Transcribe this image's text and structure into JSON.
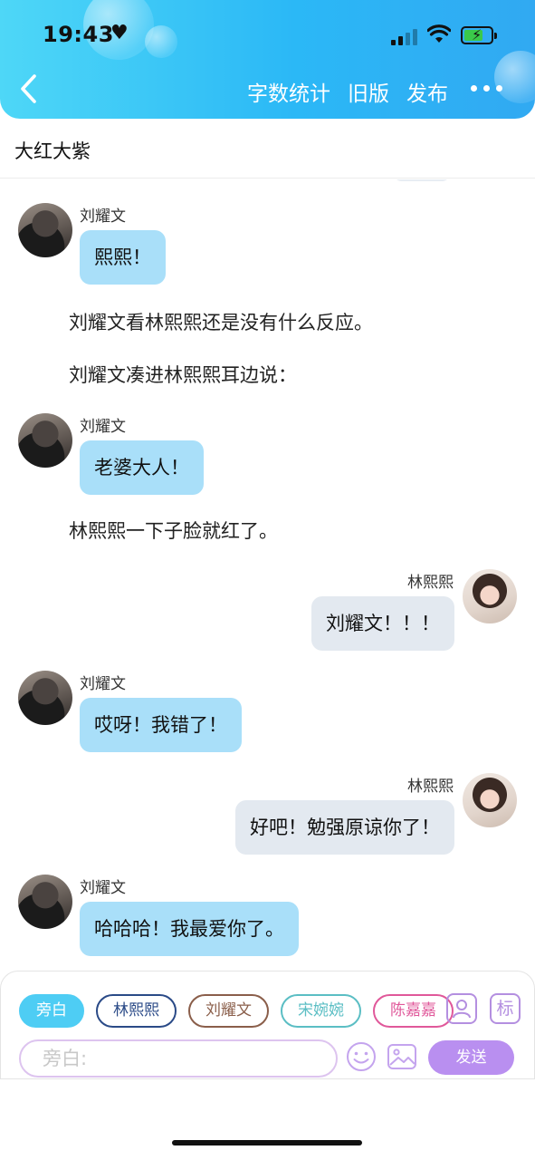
{
  "status_bar": {
    "time": "19:43",
    "time_icon": "heart"
  },
  "nav": {
    "back_icon": "chevron-left",
    "actions": [
      "字数统计",
      "旧版",
      "发布"
    ],
    "more_icon": "ellipsis"
  },
  "title": "大红大紫",
  "characters": {
    "liu": "刘耀文",
    "lin": "林熙熙"
  },
  "messages": [
    {
      "type": "left",
      "name": "刘耀文",
      "text": "熙熙！"
    },
    {
      "type": "narration",
      "text": "刘耀文看林熙熙还是没有什么反应。"
    },
    {
      "type": "narration",
      "text": "刘耀文凑进林熙熙耳边说："
    },
    {
      "type": "left",
      "name": "刘耀文",
      "text": "老婆大人！"
    },
    {
      "type": "narration",
      "text": "林熙熙一下子脸就红了。"
    },
    {
      "type": "right",
      "name": "林熙熙",
      "text": "刘耀文！！！"
    },
    {
      "type": "left",
      "name": "刘耀文",
      "text": "哎呀！我错了！"
    },
    {
      "type": "right",
      "name": "林熙熙",
      "text": "好吧！勉强原谅你了！"
    },
    {
      "type": "left",
      "name": "刘耀文",
      "text": "哈哈哈！我最爱你了。"
    }
  ],
  "composer": {
    "chips": [
      "旁白",
      "林熙熙",
      "刘耀文",
      "宋婉婉",
      "陈嘉嘉"
    ],
    "mark_label": "标",
    "input_placeholder": "旁白:",
    "send_label": "发送"
  },
  "colors": {
    "header_gradient_start": "#4ed7f7",
    "header_gradient_end": "#31a9f2",
    "left_bubble": "#a9dff9",
    "right_bubble": "#e3e9f0",
    "send_button": "#b98ff0"
  }
}
